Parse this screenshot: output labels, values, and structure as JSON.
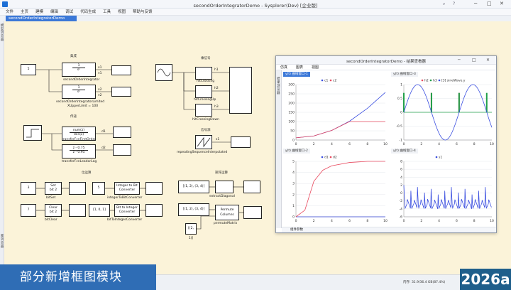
{
  "window": {
    "title": "secondOrderIntegratorDemo - Sysplorer(Dev) [企业版]"
  },
  "menu": [
    "文件",
    "主页",
    "建模",
    "编辑",
    "调试",
    "代码生成",
    "工具",
    "视图",
    "帮助与反馈"
  ],
  "doc_tab": "secondOrderIntegratorDemo",
  "left_strip": [
    "模型浏览器",
    "库浏览器"
  ],
  "sections": {
    "integrator": "集成",
    "signals": "乘信号",
    "transfer": "传递",
    "signal_gen": "信号源",
    "bit_ops": "位运算",
    "matrix_ops": "矩阵运算"
  },
  "blocks": {
    "const5": "5",
    "integ1_top": "1",
    "integ1_bot": "s²",
    "integ2_top": "1",
    "integ2_bot": "s²",
    "x1": "x1",
    "v1": "v1",
    "x2": "x2",
    "v2": "v2",
    "tf_num": "num(z)",
    "tf_den": "den(z)",
    "ll_num": "z - 0.75",
    "ll_den": "z - 0.95",
    "d1": "d1",
    "d2": "d2",
    "h1": "h1",
    "h2": "h2",
    "h3": "h3",
    "s1": "s1",
    "c3": "3",
    "c7": "7",
    "c5": "5",
    "set_bit": "Set\nbit 2",
    "clear_bit": "Clear\nbit 2",
    "i2b": "Integer to Bit\nConverter",
    "b2i": "Bit to Integer\nConverter",
    "vec": "[1, 0, 1]",
    "mat1": "[(1, 2), (3, 4)]",
    "mat2": "[(1, 2), (3, 4)]",
    "mat3": "[(2, 1)]",
    "permute": "Permute\nColumns"
  },
  "labels": {
    "soi": "secondOrderIntegrator",
    "soil": "secondOrderIntegratorLimited",
    "xupper": "XUpperLimit = 100",
    "tffo": "transferFcnFirstOrder",
    "tfll": "transferFcnLeadorLag",
    "hit": "hitCrossing",
    "hitup": "hitCrossingUp",
    "hitdown": "hitCrossingDown",
    "rsi": "repeatingSequenceInterpolated",
    "bitset": "bitSet",
    "bitclear": "bitClear",
    "i2bconv": "integerToBitConverter",
    "b2iconv": "bitToIntegerConverter",
    "extract": "extractDiagonal",
    "permute": "permuteMatrix"
  },
  "scope": {
    "title": "secondOrderIntegratorDemo - 结果查看器",
    "menu": [
      "仿真",
      "图表",
      "视图"
    ],
    "side": [
      "结果浏览器"
    ],
    "footer": "组件参数",
    "panes": [
      {
        "tab": "y(t) 曲线窗口-1",
        "legend": [
          "c1",
          "c2"
        ]
      },
      {
        "tab": "y(t) 曲线窗口-3",
        "legend": [
          "h2",
          "h3",
          "[3] sineWave.y"
        ]
      },
      {
        "tab": "y(t) 曲线窗口-2",
        "legend": [
          "d1",
          "d2"
        ]
      },
      {
        "tab": "y(t) 曲线窗口-4",
        "legend": [
          "s1"
        ]
      }
    ]
  },
  "chart_data": [
    {
      "type": "line",
      "title": "y(t) 曲线窗口-1",
      "x": [
        0,
        2,
        4,
        6,
        8,
        10
      ],
      "ylim": [
        0,
        300
      ],
      "yticks": [
        0,
        50,
        100,
        150,
        200,
        250,
        300
      ],
      "xticks": [
        0,
        2,
        4,
        6,
        8,
        10
      ],
      "series": [
        {
          "name": "c1",
          "color": "#3b4fe0",
          "values": [
            12,
            22,
            52,
            102,
            172,
            258
          ]
        },
        {
          "name": "c2",
          "color": "#e84a5f",
          "values": [
            12,
            22,
            52,
            100,
            100,
            100
          ]
        }
      ]
    },
    {
      "type": "line",
      "title": "y(t) 曲线窗口-3",
      "x": [
        0,
        10
      ],
      "ylim": [
        -1,
        1
      ],
      "yticks": [
        -1,
        -0.5,
        0,
        0.5,
        1
      ],
      "xticks": [
        0,
        2,
        4,
        6,
        8,
        10
      ],
      "series": [
        {
          "name": "h2",
          "color": "#e84a5f",
          "spikes": [
            3.14,
            6.28
          ]
        },
        {
          "name": "h3",
          "color": "#21a04a",
          "spikes": [
            0,
            3.14,
            6.28,
            9.42
          ]
        },
        {
          "name": "[3] sineWave.y",
          "color": "#3b4fe0",
          "values": "sin(t)"
        }
      ]
    },
    {
      "type": "line",
      "title": "y(t) 曲线窗口-2",
      "x": [
        0,
        1,
        2,
        3,
        4,
        6,
        8,
        10
      ],
      "ylim": [
        0,
        5
      ],
      "yticks": [
        0,
        1,
        2,
        3,
        4,
        5
      ],
      "xticks": [
        0,
        2,
        4,
        6,
        8,
        10
      ],
      "series": [
        {
          "name": "d1",
          "color": "#3b4fe0",
          "values": [
            0,
            0,
            0,
            0,
            0,
            0,
            0,
            0
          ]
        },
        {
          "name": "d2",
          "color": "#e84a5f",
          "values": [
            0,
            0.6,
            3.2,
            4.2,
            4.6,
            4.9,
            5.0,
            5.0
          ]
        }
      ]
    },
    {
      "type": "line",
      "title": "y(t) 曲线窗口-4",
      "x": [
        0,
        10
      ],
      "ylim": [
        -6,
        8
      ],
      "yticks": [
        -6,
        -4,
        -2,
        0,
        2,
        4,
        6,
        8
      ],
      "xticks": [
        0,
        2,
        4,
        6,
        8,
        10
      ],
      "series": [
        {
          "name": "s1",
          "color": "#3b4fe0",
          "periodic": true
        }
      ]
    }
  ],
  "status": {
    "memory": "内存: 31.9/36.4 GB(87.4%)"
  },
  "banner": {
    "text": "部分新增框图模块",
    "year": "2026a"
  }
}
